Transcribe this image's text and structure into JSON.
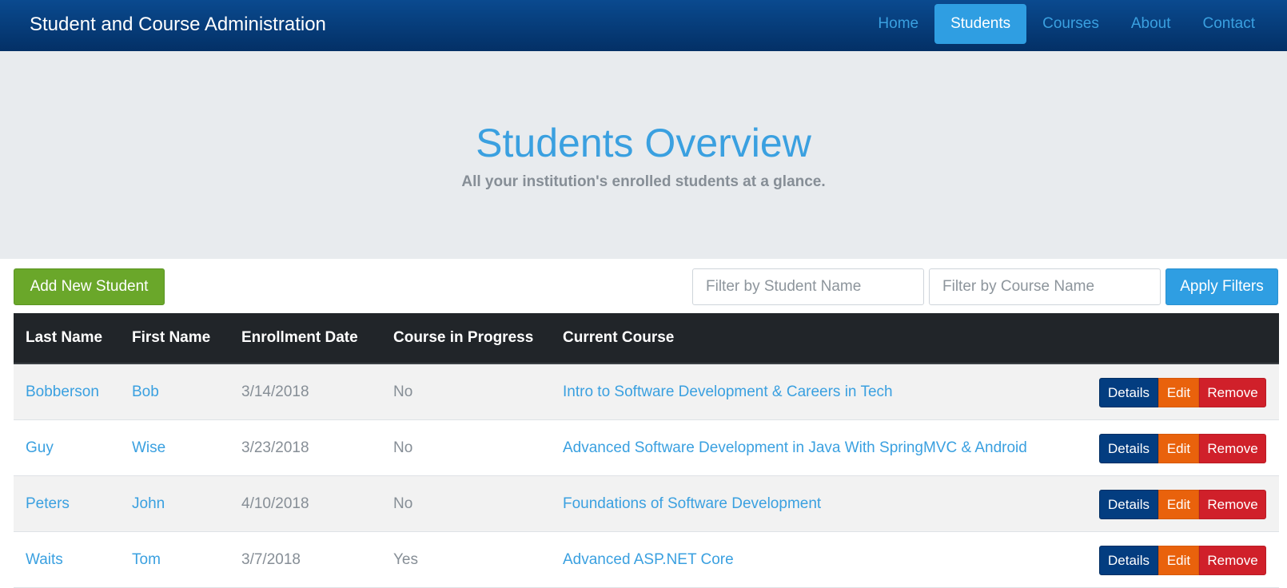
{
  "navbar": {
    "brand": "Student and Course Administration",
    "items": [
      {
        "label": "Home",
        "active": false
      },
      {
        "label": "Students",
        "active": true
      },
      {
        "label": "Courses",
        "active": false
      },
      {
        "label": "About",
        "active": false
      },
      {
        "label": "Contact",
        "active": false
      }
    ]
  },
  "jumbotron": {
    "title": "Students Overview",
    "subtitle": "All your institution's enrolled students at a glance."
  },
  "toolbar": {
    "add_label": "Add New Student",
    "filter_student_placeholder": "Filter by Student Name",
    "filter_course_placeholder": "Filter by Course Name",
    "apply_label": "Apply Filters"
  },
  "table": {
    "headers": [
      "Last Name",
      "First Name",
      "Enrollment Date",
      "Course in Progress",
      "Current Course"
    ],
    "rows": [
      {
        "last": "Bobberson",
        "first": "Bob",
        "date": "3/14/2018",
        "in_progress": "No",
        "course": "Intro to Software Development & Careers in Tech"
      },
      {
        "last": "Guy",
        "first": "Wise",
        "date": "3/23/2018",
        "in_progress": "No",
        "course": "Advanced Software Development in Java With SpringMVC & Android"
      },
      {
        "last": "Peters",
        "first": "John",
        "date": "4/10/2018",
        "in_progress": "No",
        "course": "Foundations of Software Development"
      },
      {
        "last": "Waits",
        "first": "Tom",
        "date": "3/7/2018",
        "in_progress": "Yes",
        "course": "Advanced ASP.NET Core"
      }
    ],
    "actions": {
      "details": "Details",
      "edit": "Edit",
      "remove": "Remove"
    }
  },
  "colors": {
    "navbar": "#033066",
    "accent": "#2f9ee2",
    "add_button": "#6aa72a",
    "details_button": "#033d80",
    "edit_button": "#e9620c",
    "remove_button": "#d0202a",
    "table_header": "#212529"
  }
}
